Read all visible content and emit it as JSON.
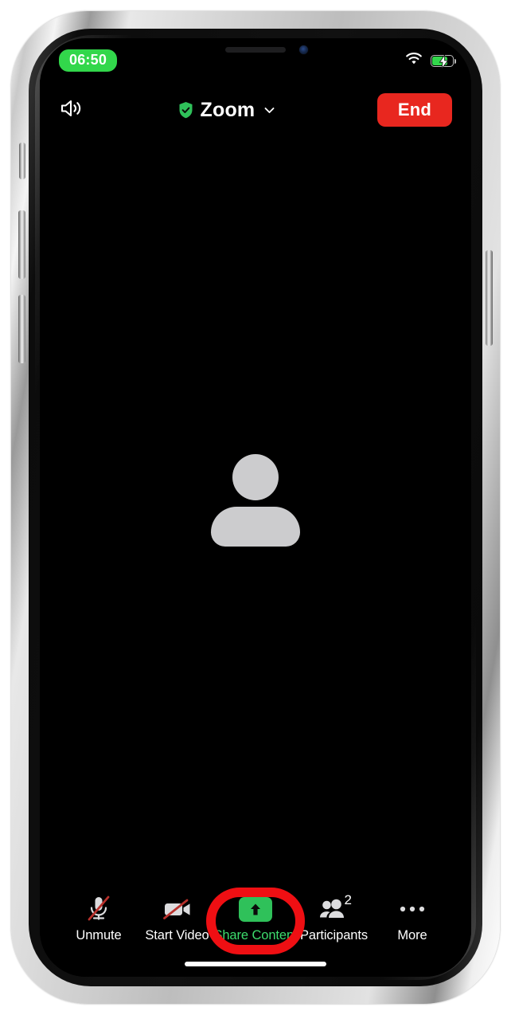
{
  "device": {
    "name": "iphone-silver",
    "frame_color": "#cfcfcf",
    "screen_bg": "#000000"
  },
  "status_bar": {
    "time": "06:50",
    "time_pill_color": "#32d74b",
    "wifi_icon": "wifi-icon",
    "battery_icon": "battery-charging-icon",
    "battery_color": "#32d74b"
  },
  "top_bar": {
    "speaker_icon": "speaker-icon",
    "shield_icon": "shield-check-icon",
    "title": "Zoom",
    "chevron_icon": "chevron-down-icon",
    "end_label": "End",
    "end_color": "#e8271f"
  },
  "stage": {
    "participant_avatar_icon": "person-placeholder-icon",
    "avatar_color": "#ccccce"
  },
  "toolbar": {
    "items": [
      {
        "label": "Unmute",
        "icon": "microphone-muted-icon",
        "highlighted": false
      },
      {
        "label": "Start Video",
        "icon": "video-camera-off-icon",
        "highlighted": false
      },
      {
        "label": "Share Content",
        "icon": "share-arrow-up-icon",
        "highlighted": true,
        "label_color": "#3ddc6d"
      },
      {
        "label": "Participants",
        "icon": "participants-icon",
        "badge": "2",
        "highlighted": false
      },
      {
        "label": "More",
        "icon": "more-dots-icon",
        "highlighted": false
      }
    ]
  },
  "annotation": {
    "shape": "oval-highlight",
    "target": "Share Content",
    "color": "#ef0f13"
  },
  "home_indicator": {
    "visible": "true"
  }
}
